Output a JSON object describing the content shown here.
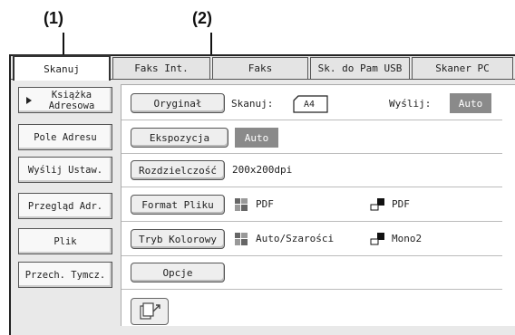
{
  "callouts": {
    "one": "(1)",
    "two": "(2)"
  },
  "tabs": [
    "Skanuj",
    "Faks Int.",
    "Faks",
    "Sk. do Pam USB",
    "Skaner PC"
  ],
  "sidebar": [
    "Książka Adresowa",
    "Pole Adresu",
    "Wyślij Ustaw.",
    "Przegląd Adr.",
    "Plik",
    "Przech. Tymcz."
  ],
  "rows": {
    "original": {
      "button": "Oryginał",
      "scan_label": "Skanuj:",
      "paper": "A4",
      "send_label": "Wyślij:",
      "send_value": "Auto"
    },
    "exposure": {
      "button": "Ekspozycja",
      "value": "Auto"
    },
    "resolution": {
      "button": "Rozdzielczość",
      "value": "200x200dpi"
    },
    "format": {
      "button": "Format Pliku",
      "color_value": "PDF",
      "mono_value": "PDF"
    },
    "color_mode": {
      "button": "Tryb Kolorowy",
      "color_value": "Auto/Szarości",
      "mono_value": "Mono2"
    },
    "options": {
      "button": "Opcje"
    }
  },
  "icons": {
    "color_mode": "color-grid-icon",
    "mono_mode": "mono-squares-icon",
    "bottom": "preview-icon",
    "sidebar_arrow": "triangle-right-icon"
  }
}
